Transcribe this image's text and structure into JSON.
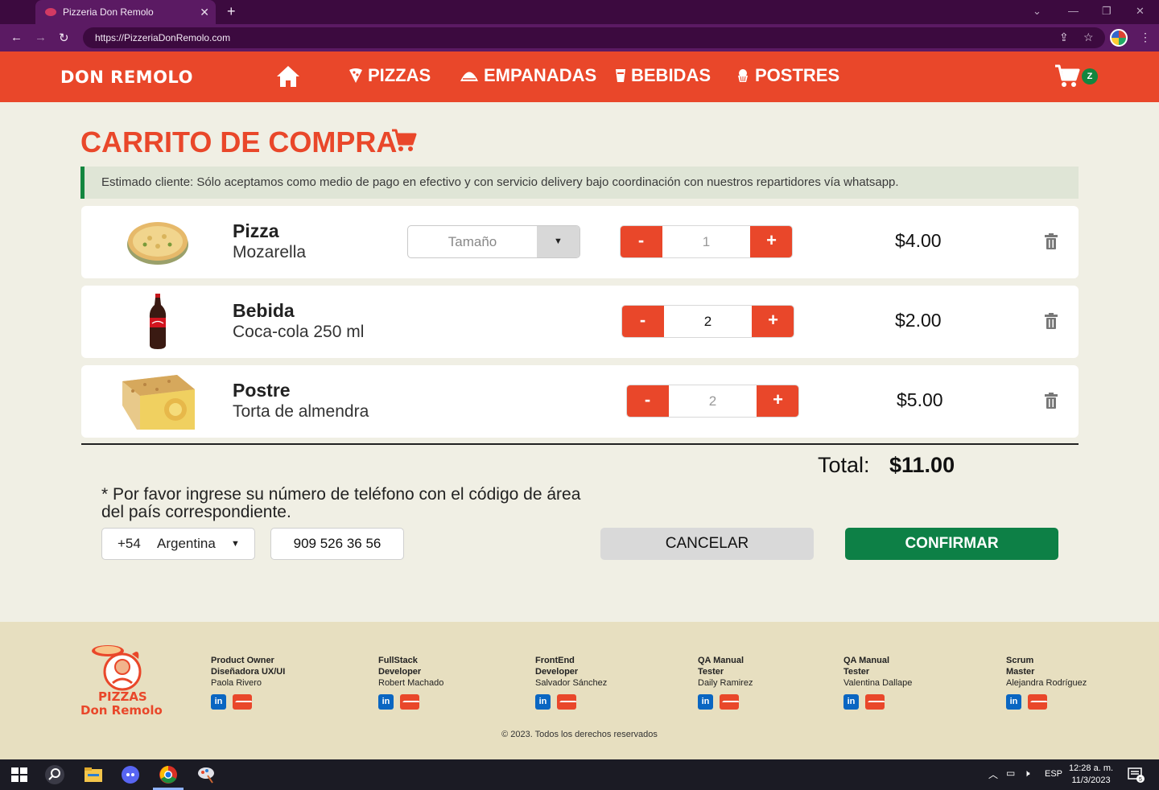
{
  "browser": {
    "tab_title": "Pizzeria Don Remolo",
    "url": "https://PizzeriaDonRemolo.com"
  },
  "header": {
    "logo": "DON REMOLO",
    "nav": [
      {
        "label": "PIZZAS",
        "icon": "pizza-slice-icon"
      },
      {
        "label": "EMPANADAS",
        "icon": "empanada-icon"
      },
      {
        "label": "BEBIDAS",
        "icon": "cup-icon"
      },
      {
        "label": "POSTRES",
        "icon": "cupcake-icon"
      }
    ],
    "cart_badge": "Z"
  },
  "page": {
    "title": "CARRITO DE COMPRA",
    "notice": "Estimado cliente: Sólo aceptamos como medio de pago en efectivo y con servicio delivery bajo coordinación con nuestros repartidores vía whatsapp."
  },
  "items": [
    {
      "name": "Pizza",
      "desc": "Mozarella",
      "size_placeholder": "Tamaño",
      "qty": "1",
      "price": "$4.00"
    },
    {
      "name": "Bebida",
      "desc": "Coca-cola 250 ml",
      "qty": "2",
      "price": "$2.00"
    },
    {
      "name": "Postre",
      "desc": "Torta de almendra",
      "qty": "2",
      "price": "$5.00"
    }
  ],
  "total": {
    "label": "Total:",
    "value": "$11.00"
  },
  "phone": {
    "note": "* Por favor ingrese su número de teléfono con el código de área del país correspondiente.",
    "country_code": "+54",
    "country_name": "Argentina",
    "number": "909 526 36 56"
  },
  "actions": {
    "cancel": "CANCELAR",
    "confirm": "CONFIRMAR"
  },
  "footer": {
    "brand_line1": "PIZZAS",
    "brand_line2": "Don Remolo",
    "team": [
      {
        "role1": "Product Owner",
        "role2": "Diseñadora UX/UI",
        "name": "Paola Rivero"
      },
      {
        "role1": "FullStack",
        "role2": "Developer",
        "name": "Robert Machado"
      },
      {
        "role1": "FrontEnd",
        "role2": "Developer",
        "name": "Salvador Sánchez"
      },
      {
        "role1": "QA Manual",
        "role2": "Tester",
        "name": "Daily Ramirez"
      },
      {
        "role1": "QA Manual",
        "role2": "Tester",
        "name": "Valentina Dallape"
      },
      {
        "role1": "Scrum",
        "role2": "Master",
        "name": "Alejandra Rodríguez"
      }
    ],
    "copyright": "© 2023. Todos los derechos reservados"
  },
  "taskbar": {
    "lang": "ESP",
    "time": "12:28 a. m.",
    "date": "11/3/2023",
    "notifications": "5"
  },
  "colors": {
    "brand": "#e9472a",
    "confirm": "#0d8046",
    "background": "#f0efe4"
  }
}
